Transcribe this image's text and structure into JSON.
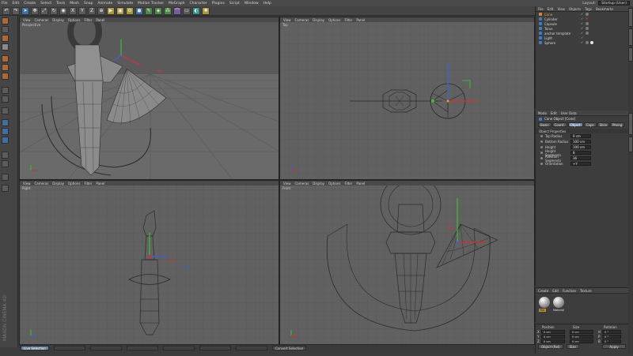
{
  "menubar": {
    "items": [
      "File",
      "Edit",
      "Create",
      "Select",
      "Tools",
      "Mesh",
      "Snap",
      "Animate",
      "Simulate",
      "Motion Tracker",
      "MoGraph",
      "Character",
      "Plugins",
      "Script",
      "Window",
      "Help"
    ],
    "layout_label": "Layout:",
    "layout_value": "Startup (User)"
  },
  "viewports": [
    {
      "name": "Perspective",
      "menu": [
        "View",
        "Cameras",
        "Display",
        "Options",
        "Filter",
        "Panel"
      ]
    },
    {
      "name": "Top",
      "menu": [
        "View",
        "Cameras",
        "Display",
        "Options",
        "Filter",
        "Panel"
      ]
    },
    {
      "name": "Right",
      "menu": [
        "View",
        "Cameras",
        "Display",
        "Options",
        "Filter",
        "Panel"
      ]
    },
    {
      "name": "Front",
      "menu": [
        "View",
        "Cameras",
        "Display",
        "Options",
        "Filter",
        "Panel"
      ]
    }
  ],
  "object_manager": {
    "menu": [
      "File",
      "Edit",
      "View",
      "Objects",
      "Tags",
      "Bookmarks"
    ],
    "objects": [
      {
        "name": "Cone",
        "active": true
      },
      {
        "name": "Cylinder",
        "active": false
      },
      {
        "name": "Capsule",
        "active": false
      },
      {
        "name": "Torus",
        "active": false
      },
      {
        "name": "anchor template",
        "active": false
      },
      {
        "name": "Light",
        "active": false
      },
      {
        "name": "Sphere",
        "active": false
      }
    ]
  },
  "attributes": {
    "menu": [
      "Mode",
      "Edit",
      "User Data"
    ],
    "title": "Cone Object [Cone]",
    "tabs": [
      "Basic",
      "Coord.",
      "Object",
      "Caps",
      "Slice",
      "Phong"
    ],
    "active_tab": "Object",
    "section": "Object Properties",
    "props": [
      {
        "label": "Top Radius",
        "value": "0 cm"
      },
      {
        "label": "Bottom Radius",
        "value": "100 cm"
      },
      {
        "label": "Height",
        "value": "100 cm"
      },
      {
        "label": "Height Segments",
        "value": "8"
      },
      {
        "label": "Rotation Segments",
        "value": "36"
      },
      {
        "label": "Orientation",
        "value": "+Y"
      }
    ]
  },
  "materials": {
    "menu": [
      "Create",
      "Edit",
      "Function",
      "Texture"
    ],
    "items": [
      {
        "name": "Mat",
        "active": true
      },
      {
        "name": "Material",
        "active": false
      }
    ]
  },
  "coordinates": {
    "headers": [
      "Position",
      "Size",
      "Rotation"
    ],
    "rows": [
      {
        "axis": "X",
        "pos": "0 cm",
        "size": "0 cm",
        "rot_axis": "H",
        "rot": "0 °"
      },
      {
        "axis": "Y",
        "pos": "0 cm",
        "size": "0 cm",
        "rot_axis": "P",
        "rot": "0 °"
      },
      {
        "axis": "Z",
        "pos": "0 cm",
        "size": "0 cm",
        "rot_axis": "B",
        "rot": "0 °"
      }
    ],
    "mode": "Object (Rel)",
    "size_mode": "Size",
    "apply": "Apply"
  },
  "statusbar": {
    "items": [
      "Live Selection",
      "Convert Selection"
    ]
  },
  "brand": "MAXON CINEMA 4D"
}
